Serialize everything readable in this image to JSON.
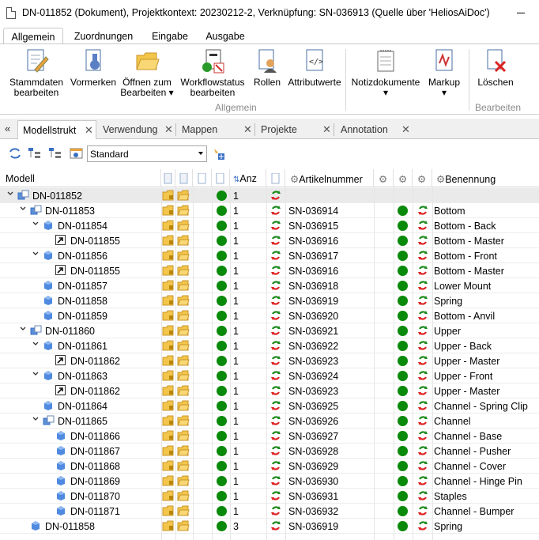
{
  "window": {
    "title": "DN-011852 (Dokument), Projektkontext: 20230212-2, Verknüpfung: SN-036913 (Quelle über 'HeliosAiDoc')"
  },
  "ribbon_tabs": [
    "Allgemein",
    "Zuordnungen",
    "Eingabe",
    "Ausgabe"
  ],
  "ribbon": {
    "buttons": [
      {
        "label": "Stammdaten\nbearbeiten",
        "icon": "edit-master-data-icon"
      },
      {
        "label": "Vormerken",
        "icon": "reserve-icon"
      },
      {
        "label": "Öffnen zum\nBearbeiten ▾",
        "icon": "open-folder-icon"
      },
      {
        "label": "Workflowstatus\nbearbeiten",
        "icon": "workflow-status-icon"
      },
      {
        "label": "Rollen",
        "icon": "roles-icon"
      },
      {
        "label": "Attributwerte",
        "icon": "attribute-values-icon"
      },
      {
        "label": "Notizdokumente\n▾",
        "icon": "note-documents-icon"
      },
      {
        "label": "Markup\n▾",
        "icon": "markup-icon"
      },
      {
        "label": "Löschen",
        "icon": "delete-icon"
      }
    ],
    "groups": [
      "Allgemein",
      "Bearbeiten"
    ]
  },
  "doc_tabs": [
    "Modellstrukt",
    "Verwendung",
    "Mappen",
    "Projekte",
    "Annotation"
  ],
  "toolbar": {
    "view_select": "Standard"
  },
  "columns": {
    "model": "Modell",
    "count": "Anz",
    "article": "Artikelnummer",
    "name": "Benennung"
  },
  "rows": [
    {
      "level": 0,
      "expand": "down",
      "type": "assembly",
      "model": "DN-011852",
      "count": "1",
      "article": "",
      "name": "",
      "folder": true,
      "selected": true,
      "status": false
    },
    {
      "level": 1,
      "expand": "down",
      "type": "assembly",
      "model": "DN-011853",
      "count": "1",
      "article": "SN-036914",
      "name": "Bottom",
      "status": true
    },
    {
      "level": 2,
      "expand": "down",
      "type": "part",
      "model": "DN-011854",
      "count": "1",
      "article": "SN-036915",
      "name": "Bottom - Back",
      "status": true
    },
    {
      "level": 3,
      "expand": "",
      "type": "link",
      "model": "DN-011855",
      "count": "1",
      "article": "SN-036916",
      "name": "Bottom - Master",
      "status": true
    },
    {
      "level": 2,
      "expand": "down",
      "type": "part",
      "model": "DN-011856",
      "count": "1",
      "article": "SN-036917",
      "name": "Bottom - Front",
      "status": true
    },
    {
      "level": 3,
      "expand": "",
      "type": "link",
      "model": "DN-011855",
      "count": "1",
      "article": "SN-036916",
      "name": "Bottom - Master",
      "status": true
    },
    {
      "level": 2,
      "expand": "",
      "type": "part",
      "model": "DN-011857",
      "count": "1",
      "article": "SN-036918",
      "name": "Lower Mount",
      "status": true
    },
    {
      "level": 2,
      "expand": "",
      "type": "part",
      "model": "DN-011858",
      "count": "1",
      "article": "SN-036919",
      "name": "Spring",
      "status": true
    },
    {
      "level": 2,
      "expand": "",
      "type": "part",
      "model": "DN-011859",
      "count": "1",
      "article": "SN-036920",
      "name": "Bottom - Anvil",
      "status": true
    },
    {
      "level": 1,
      "expand": "down",
      "type": "assembly",
      "model": "DN-011860",
      "count": "1",
      "article": "SN-036921",
      "name": "Upper",
      "status": true
    },
    {
      "level": 2,
      "expand": "down",
      "type": "part",
      "model": "DN-011861",
      "count": "1",
      "article": "SN-036922",
      "name": "Upper - Back",
      "status": true
    },
    {
      "level": 3,
      "expand": "",
      "type": "link",
      "model": "DN-011862",
      "count": "1",
      "article": "SN-036923",
      "name": "Upper - Master",
      "status": true
    },
    {
      "level": 2,
      "expand": "down",
      "type": "part",
      "model": "DN-011863",
      "count": "1",
      "article": "SN-036924",
      "name": "Upper - Front",
      "status": true
    },
    {
      "level": 3,
      "expand": "",
      "type": "link",
      "model": "DN-011862",
      "count": "1",
      "article": "SN-036923",
      "name": "Upper - Master",
      "status": true
    },
    {
      "level": 2,
      "expand": "",
      "type": "part",
      "model": "DN-011864",
      "count": "1",
      "article": "SN-036925",
      "name": "Channel - Spring Clip",
      "status": true
    },
    {
      "level": 2,
      "expand": "down",
      "type": "assembly",
      "model": "DN-011865",
      "count": "1",
      "article": "SN-036926",
      "name": "Channel",
      "status": true
    },
    {
      "level": 3,
      "expand": "",
      "type": "part",
      "model": "DN-011866",
      "count": "1",
      "article": "SN-036927",
      "name": "Channel - Base",
      "status": true
    },
    {
      "level": 3,
      "expand": "",
      "type": "part",
      "model": "DN-011867",
      "count": "1",
      "article": "SN-036928",
      "name": "Channel - Pusher",
      "status": true
    },
    {
      "level": 3,
      "expand": "",
      "type": "part",
      "model": "DN-011868",
      "count": "1",
      "article": "SN-036929",
      "name": "Channel - Cover",
      "status": true
    },
    {
      "level": 3,
      "expand": "",
      "type": "part",
      "model": "DN-011869",
      "count": "1",
      "article": "SN-036930",
      "name": "Channel - Hinge Pin",
      "status": true
    },
    {
      "level": 3,
      "expand": "",
      "type": "part",
      "model": "DN-011870",
      "count": "1",
      "article": "SN-036931",
      "name": "Staples",
      "status": true
    },
    {
      "level": 3,
      "expand": "",
      "type": "part",
      "model": "DN-011871",
      "count": "1",
      "article": "SN-036932",
      "name": "Channel - Bumper",
      "status": true
    },
    {
      "level": 1,
      "expand": "",
      "type": "part",
      "model": "DN-011858",
      "count": "3",
      "article": "SN-036919",
      "name": "Spring",
      "status": true
    }
  ]
}
